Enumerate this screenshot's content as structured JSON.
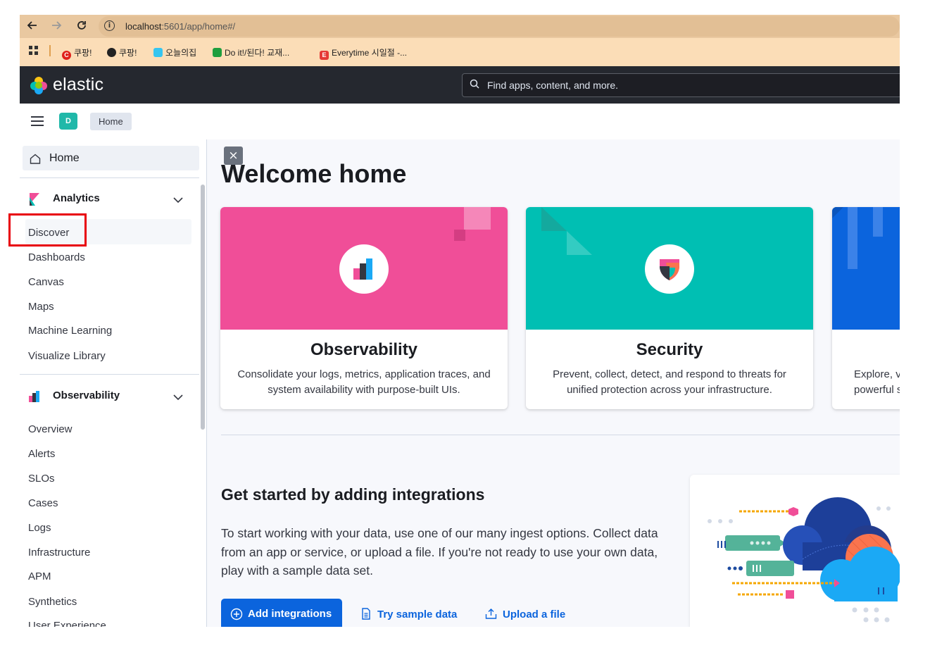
{
  "browser": {
    "url_host": "localhost",
    "url_rest": ":5601/app/home#/",
    "bookmarks": [
      {
        "label": "쿠팡!",
        "icon": "coupang-icon",
        "color": "#e0201b",
        "glyph": "C"
      },
      {
        "label": "쿠팡!",
        "icon": "globe-icon",
        "color": "#222222",
        "glyph": ""
      },
      {
        "label": "오늘의집",
        "icon": "ohouse-icon",
        "color": "#35c5f0",
        "glyph": ""
      },
      {
        "label": "Do it!/된다! 교재...",
        "icon": "doit-icon",
        "color": "#1e9e3e",
        "glyph": ""
      },
      {
        "label": "Everytime 시일절 -...",
        "icon": "everytime-icon",
        "color": "#e53935",
        "glyph": "E"
      }
    ]
  },
  "header": {
    "logo_text": "elastic",
    "search_placeholder": "Find apps, content, and more."
  },
  "breadcrumb": {
    "space_initial": "D",
    "current": "Home"
  },
  "sidebar": {
    "home_label": "Home",
    "analytics": {
      "label": "Analytics",
      "items": [
        "Discover",
        "Dashboards",
        "Canvas",
        "Maps",
        "Machine Learning",
        "Visualize Library"
      ]
    },
    "observability": {
      "label": "Observability",
      "items": [
        "Overview",
        "Alerts",
        "SLOs",
        "Cases",
        "Logs",
        "Infrastructure",
        "APM",
        "Synthetics",
        "User Experience"
      ]
    }
  },
  "main": {
    "title": "Welcome home",
    "cards": [
      {
        "title": "Observability",
        "description": "Consolidate your logs, metrics, application traces, and system availability with purpose-built UIs.",
        "color": "#f04e98"
      },
      {
        "title": "Security",
        "description": "Prevent, collect, detect, and respond to threats for unified protection across your infrastructure.",
        "color": "#00bfb3"
      },
      {
        "title": "",
        "description": "Explore, v\npowerful s",
        "color": "#0b64dd"
      }
    ],
    "integrations": {
      "heading": "Get started by adding integrations",
      "text": "To start working with your data, use one of our many ingest options. Collect data from an app or service, or upload a file. If you're not ready to use your own data, play with a sample data set.",
      "add_button": "Add integrations",
      "sample_button": "Try sample data",
      "upload_button": "Upload a file"
    }
  },
  "colors": {
    "header_bg": "#25282f",
    "primary": "#0b64dd",
    "highlight_border": "#e8000b"
  }
}
